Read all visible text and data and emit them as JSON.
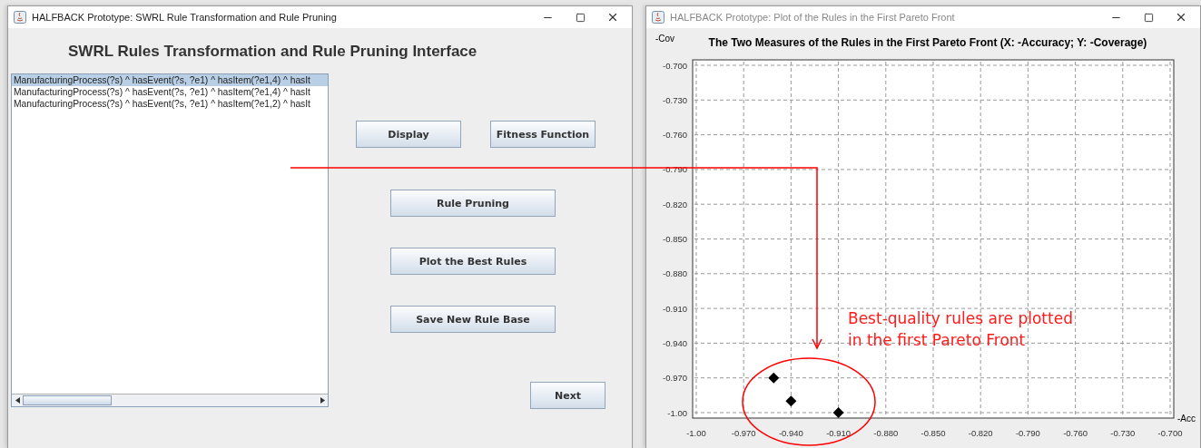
{
  "left_window": {
    "title": "HALFBACK Prototype: SWRL Rule Transformation and Rule Pruning",
    "heading": "SWRL Rules Transformation and Rule Pruning Interface",
    "rules": [
      {
        "text": "ManufacturingProcess(?s) ^ hasEvent(?s, ?e1)  ^ hasItem(?e1,4) ^ hasIt",
        "selected": true
      },
      {
        "text": "ManufacturingProcess(?s) ^ hasEvent(?s, ?e1)  ^ hasItem(?e1,4) ^ hasIt",
        "selected": false
      },
      {
        "text": "ManufacturingProcess(?s) ^ hasEvent(?s, ?e1)  ^ hasItem(?e1,2) ^ hasIt",
        "selected": false
      }
    ],
    "buttons": [
      "Display",
      "Fitness Function",
      "Rule Pruning",
      "Plot the Best Rules",
      "Save New Rule Base",
      "Next"
    ]
  },
  "right_window": {
    "title": "HALFBACK Prototype: Plot of the Rules in the First Pareto Front",
    "chart_data": {
      "type": "scatter",
      "title": "The Two Measures of the Rules in the First Pareto Front (X: -Accuracy; Y: -Coverage)",
      "xlabel": "-Acc",
      "ylabel": "-Cov",
      "x": [
        -0.951,
        -0.94,
        -0.91
      ],
      "series": [
        {
          "color": "#000000",
          "values": [
            -0.97,
            -0.99,
            -1.0
          ]
        }
      ],
      "grid": true,
      "xlim": [
        -1.0,
        -0.7
      ],
      "ylim": [
        -1.0,
        -0.7
      ],
      "xticks": [
        {
          "value": -1.0,
          "label": "-1.00"
        },
        {
          "value": -0.97,
          "label": "-0.970"
        },
        {
          "value": -0.94,
          "label": "-0.940"
        },
        {
          "value": -0.91,
          "label": "-0.910"
        },
        {
          "value": -0.88,
          "label": "-0.880"
        },
        {
          "value": -0.85,
          "label": "-0.850"
        },
        {
          "value": -0.82,
          "label": "-0.820"
        },
        {
          "value": -0.79,
          "label": "-0.790"
        },
        {
          "value": -0.76,
          "label": "-0.760"
        },
        {
          "value": -0.73,
          "label": "-0.730"
        },
        {
          "value": -0.7,
          "label": "-0.700"
        }
      ],
      "yticks": [
        {
          "value": -0.7,
          "label": "-0.700"
        },
        {
          "value": -0.73,
          "label": "-0.730"
        },
        {
          "value": -0.76,
          "label": "-0.760"
        },
        {
          "value": -0.79,
          "label": "-0.790"
        },
        {
          "value": -0.82,
          "label": "-0.820"
        },
        {
          "value": -0.85,
          "label": "-0.850"
        },
        {
          "value": -0.88,
          "label": "-0.880"
        },
        {
          "value": -0.91,
          "label": "-0.910"
        },
        {
          "value": -0.94,
          "label": "-0.940"
        },
        {
          "value": -0.97,
          "label": "-0.970"
        },
        {
          "value": -1.0,
          "label": "-1.00"
        }
      ]
    }
  },
  "annotation": {
    "lines": [
      "Best-quality rules are plotted",
      "in the first Pareto Front"
    ]
  }
}
